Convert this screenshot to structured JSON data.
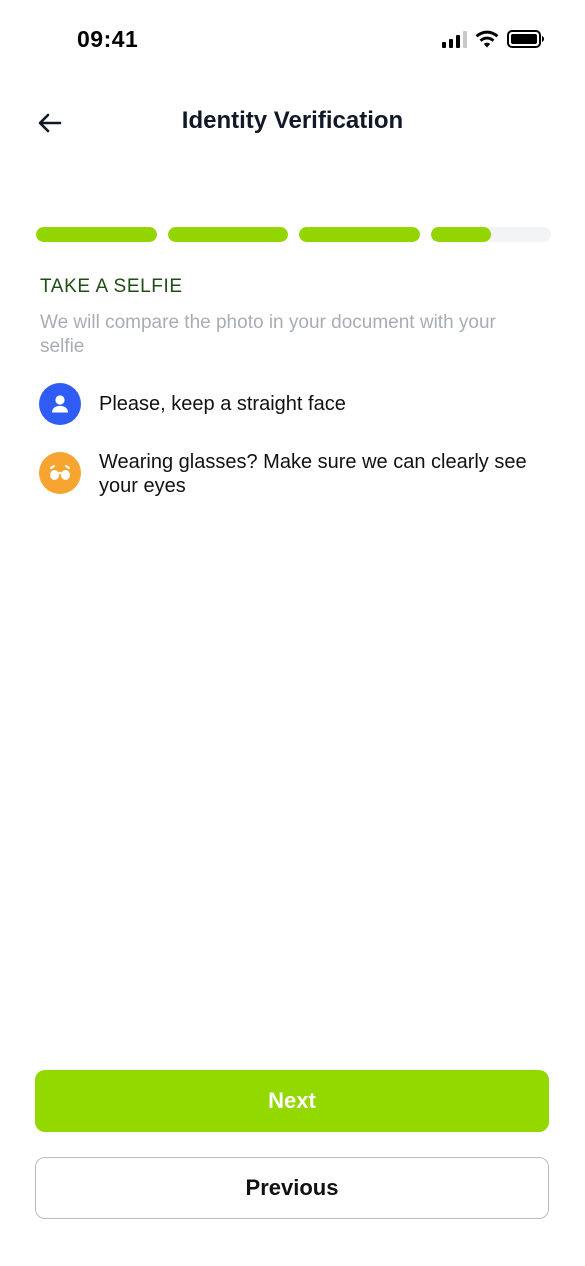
{
  "status_bar": {
    "time": "09:41"
  },
  "header": {
    "title": "Identity Verification"
  },
  "progress": {
    "segments": [
      1,
      1,
      1,
      0.5
    ],
    "accent_color": "#93d500"
  },
  "section": {
    "title": "TAKE A SELFIE",
    "subtitle": "We will compare the photo in your document with your selfie"
  },
  "tips": [
    {
      "icon": "user-icon",
      "text": "Please, keep a straight face",
      "color": "#2f5cf5"
    },
    {
      "icon": "glasses-icon",
      "text": "Wearing glasses? Make sure we can clearly see your eyes",
      "color": "#f7a530"
    }
  ],
  "buttons": {
    "next_label": "Next",
    "previous_label": "Previous"
  }
}
